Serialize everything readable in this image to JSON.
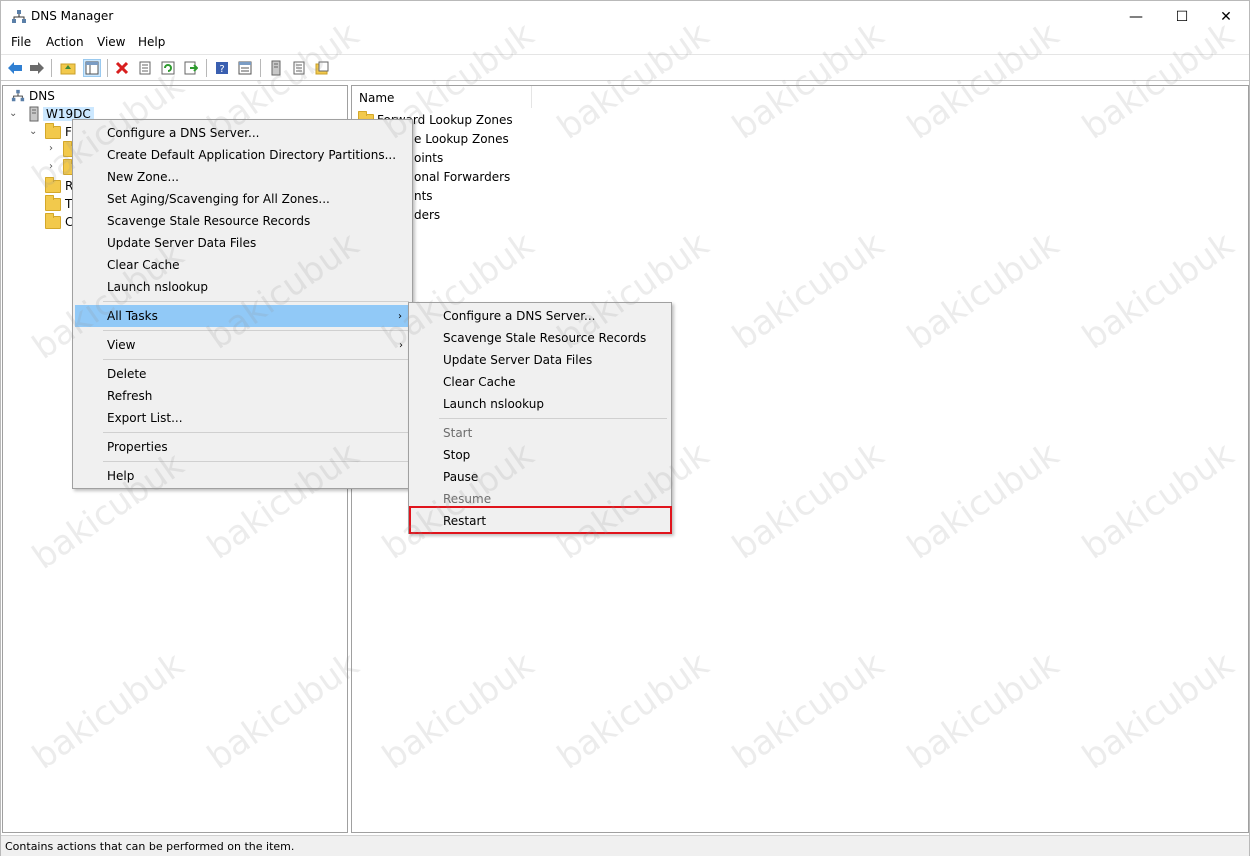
{
  "window": {
    "title": "DNS Manager",
    "controls": {
      "minimize": "—",
      "maximize": "☐",
      "close": "✕"
    }
  },
  "menubar": [
    "File",
    "Action",
    "View",
    "Help"
  ],
  "toolbar": {
    "icons": [
      "back-arrow-icon",
      "forward-arrow-icon",
      "up-folder-icon",
      "show-hide-tree-icon",
      "delete-icon",
      "properties-icon",
      "refresh-icon",
      "export-list-icon",
      "help-icon",
      "show-console-icon",
      "server-icon",
      "list-icon",
      "zone-icon"
    ]
  },
  "tree": {
    "root": "DNS",
    "server": "W19DC",
    "children": [
      "F",
      "",
      "",
      "R",
      "T",
      "C"
    ]
  },
  "list": {
    "header": "Name",
    "items": [
      "Forward Lookup Zones",
      "e Lookup Zones",
      "oints",
      "onal Forwarders",
      "nts",
      "ders"
    ]
  },
  "context_menu": {
    "items": [
      "Configure a DNS Server...",
      "Create Default Application Directory Partitions...",
      "New Zone...",
      "Set Aging/Scavenging for All Zones...",
      "Scavenge Stale Resource Records",
      "Update Server Data Files",
      "Clear Cache",
      "Launch nslookup",
      "All Tasks",
      "View",
      "Delete",
      "Refresh",
      "Export List...",
      "Properties",
      "Help"
    ]
  },
  "submenu": {
    "items": [
      "Configure a DNS Server...",
      "Scavenge Stale Resource Records",
      "Update Server Data Files",
      "Clear Cache",
      "Launch nslookup",
      "Start",
      "Stop",
      "Pause",
      "Resume",
      "Restart"
    ]
  },
  "status": "Contains actions that can be performed on the item.",
  "watermark": "bakicubuk",
  "colors": {
    "highlight": "#91c9f7",
    "selected": "#cce8ff",
    "annotation": "#e0141c",
    "menu_bg": "#f0f0f0"
  }
}
